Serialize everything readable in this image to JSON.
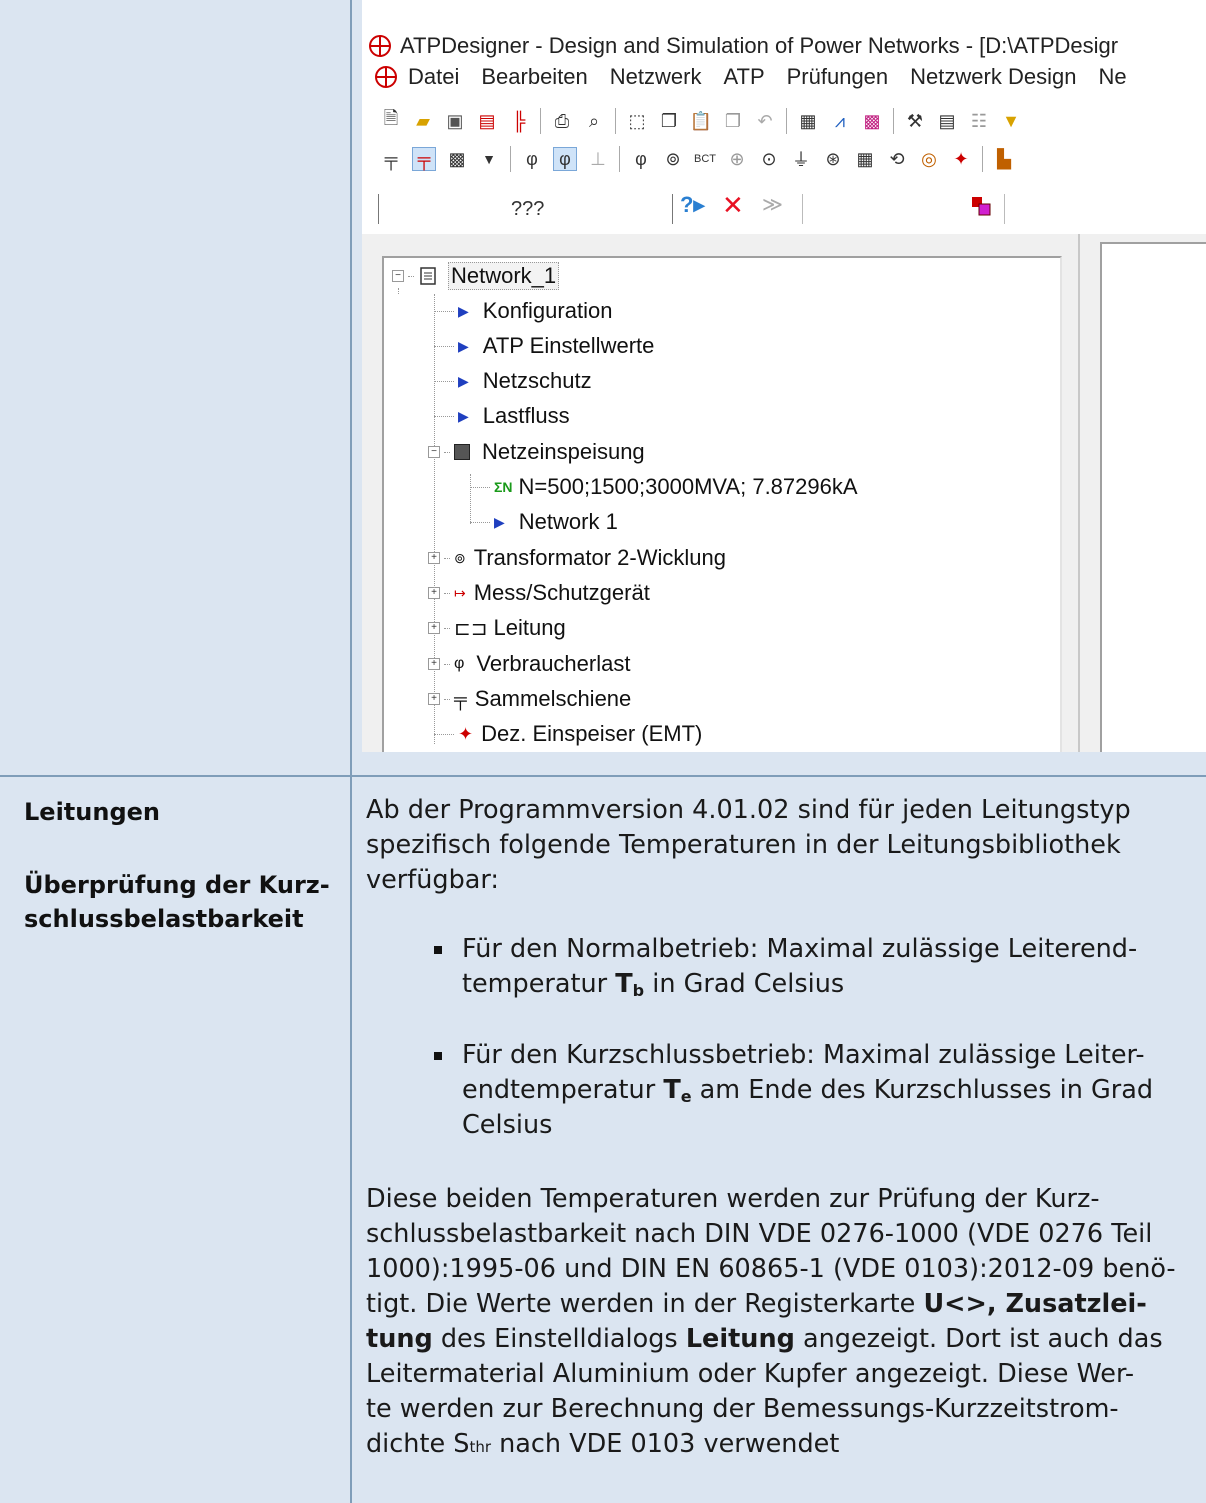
{
  "screenshot": {
    "window_title": "ATPDesigner - Design and Simulation of Power Networks - [D:\\ATPDesigr",
    "menu": [
      "Datei",
      "Bearbeiten",
      "Netzwerk",
      "ATP",
      "Prüfungen",
      "Netzwerk Design",
      "Ne"
    ],
    "combo_value": "???",
    "tree": {
      "root": "Network_1",
      "children": [
        "Konfiguration",
        "ATP Einstellwerte",
        "Netzschutz",
        "Lastfluss",
        "Netzeinspeisung",
        "N=500;1500;3000MVA; 7.87296kA",
        "Network 1",
        "Transformator 2-Wicklung",
        "Mess/Schutzgerät",
        "Leitung",
        "Verbraucherlast",
        "Sammelschiene",
        "Dez. Einspeiser (EMT)"
      ],
      "sigma_prefix": "ΣN"
    }
  },
  "left": {
    "heading1": "Leitungen",
    "heading2a": "Überprüfung der Kurz-",
    "heading2b": "schlussbelastbarkeit"
  },
  "body": {
    "intro_l1": "Ab der Programmversion 4.01.02 sind für jeden Leitungstyp",
    "intro_l2": "spezifisch folgende Temperaturen in der Leitungsbibliothek",
    "intro_l3": "verfügbar:",
    "b1_l1": "Für den Normalbetrieb: Maximal zulässige Leiterend-",
    "b1_l2a": "temperatur ",
    "b1_T": "T",
    "b1_sub": "b",
    "b1_l2b": " in Grad Celsius",
    "b2_l1": "Für den Kurzschlussbetrieb: Maximal zulässige Leiter-",
    "b2_l2a": "endtemperatur ",
    "b2_T": "T",
    "b2_sub": "e",
    "b2_l2b": " am Ende des Kurzschlusses in Grad",
    "b2_l3": "Celsius",
    "p2_l1": "Diese beiden Temperaturen werden zur Prüfung der Kurz-",
    "p2_l2": "schlussbelastbarkeit nach DIN VDE 0276-1000 (VDE 0276 Teil",
    "p2_l3": "1000):1995-06 und DIN EN 60865-1 (VDE 0103):2012-09 benö-",
    "p2_l4a": "tigt. Die Werte werden in der Registerkarte ",
    "p2_l4b": "U<>, Zusatzlei-",
    "p2_l5a": "tung",
    "p2_l5b": " des Einstelldialogs ",
    "p2_l5c": "Leitung",
    "p2_l5d": " angezeigt. Dort ist auch das",
    "p2_l6": "Leitermaterial Aluminium oder Kupfer angezeigt. Diese Wer-",
    "p2_l7": "te werden zur Berechnung der Bemessungs-Kurzzeitstrom-",
    "p2_l8a": "dichte S",
    "p2_l8sub": "thr",
    "p2_l8b": " nach VDE 0103 verwendet"
  }
}
